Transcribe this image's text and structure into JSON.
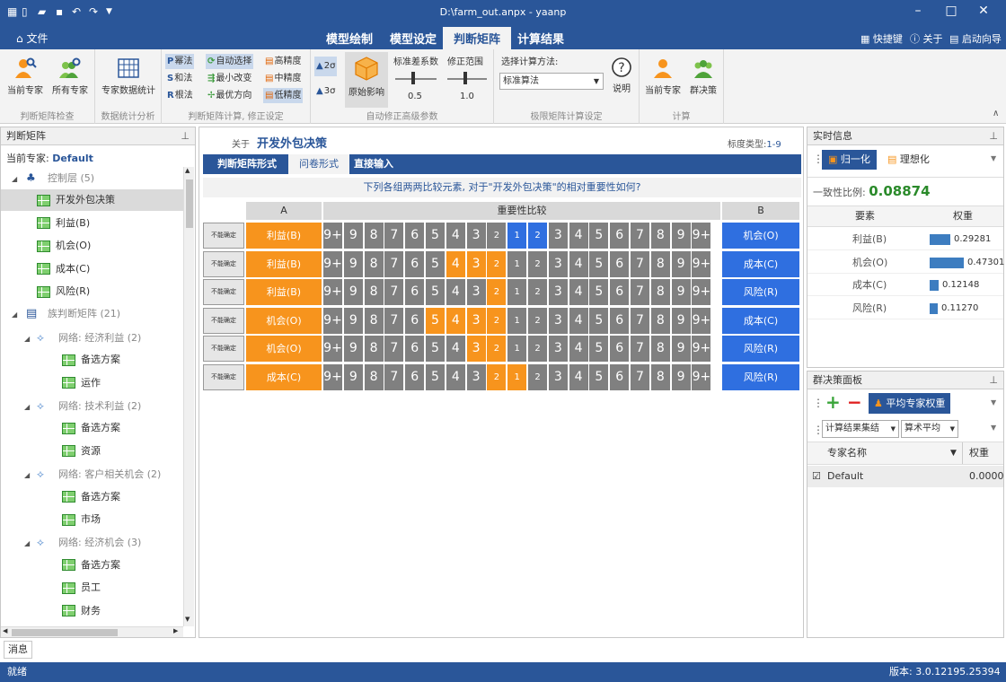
{
  "window": {
    "title": "D:\\farm_out.anpx - yaanp"
  },
  "menu": {
    "file": "文件",
    "tabs": [
      "模型绘制",
      "模型设定",
      "判断矩阵",
      "计算结果"
    ],
    "active": 2,
    "shortcut": "快捷键",
    "about": "关于",
    "wizard": "启动向导"
  },
  "ribbon": {
    "g1": {
      "caption": "判断矩阵检查",
      "b1": "当前专家",
      "b2": "所有专家"
    },
    "g2": {
      "caption": "数据统计分析",
      "b1": "专家数据统计"
    },
    "g3": {
      "caption": "判断矩阵计算, 修正设定",
      "pow": "幂法",
      "sum": "和法",
      "root": "根法",
      "auto": "自动选择",
      "minchg": "最小改变",
      "optdir": "最优方向",
      "high": "高精度",
      "mid": "中精度",
      "low": "低精度"
    },
    "g4": {
      "caption": "自动修正高级参数",
      "s2": "2σ",
      "s3": "3σ",
      "orig": "原始影响",
      "stddev": "标准差系数",
      "stddev_val": "0.5",
      "range": "修正范围",
      "range_val": "1.0"
    },
    "g5": {
      "caption": "极限矩阵计算设定",
      "label": "选择计算方法:",
      "method": "标准算法",
      "help": "说明"
    },
    "g6": {
      "caption": "计算",
      "b1": "当前专家",
      "b2": "群决策"
    }
  },
  "left": {
    "title": "判断矩阵",
    "expert_label": "当前专家:",
    "expert": "Default",
    "tree": [
      {
        "t": "控制层 (5)",
        "lv": 0,
        "kind": "hier",
        "exp": true
      },
      {
        "t": "开发外包决策",
        "lv": 1,
        "kind": "grid",
        "sel": true
      },
      {
        "t": "利益(B)",
        "lv": 1,
        "kind": "grid"
      },
      {
        "t": "机会(O)",
        "lv": 1,
        "kind": "grid"
      },
      {
        "t": "成本(C)",
        "lv": 1,
        "kind": "grid"
      },
      {
        "t": "风险(R)",
        "lv": 1,
        "kind": "grid"
      },
      {
        "t": "族判断矩阵 (21)",
        "lv": 0,
        "kind": "doc",
        "exp": true
      },
      {
        "t": "网络: 经济利益 (2)",
        "lv": 1,
        "kind": "net",
        "exp": true
      },
      {
        "t": "备选方案",
        "lv": 2,
        "kind": "grid"
      },
      {
        "t": "运作",
        "lv": 2,
        "kind": "grid"
      },
      {
        "t": "网络: 技术利益 (2)",
        "lv": 1,
        "kind": "net",
        "exp": true
      },
      {
        "t": "备选方案",
        "lv": 2,
        "kind": "grid"
      },
      {
        "t": "资源",
        "lv": 2,
        "kind": "grid"
      },
      {
        "t": "网络: 客户相关机会 (2)",
        "lv": 1,
        "kind": "net",
        "exp": true
      },
      {
        "t": "备选方案",
        "lv": 2,
        "kind": "grid"
      },
      {
        "t": "市场",
        "lv": 2,
        "kind": "grid"
      },
      {
        "t": "网络: 经济机会 (3)",
        "lv": 1,
        "kind": "net",
        "exp": true
      },
      {
        "t": "备选方案",
        "lv": 2,
        "kind": "grid"
      },
      {
        "t": "员工",
        "lv": 2,
        "kind": "grid"
      },
      {
        "t": "财务",
        "lv": 2,
        "kind": "grid"
      }
    ]
  },
  "center": {
    "about": "关于",
    "node": "开发外包决策",
    "scale_label": "标度类型:",
    "scale": "1-9",
    "tabs": [
      "判断矩阵形式",
      "问卷形式",
      "直接输入"
    ],
    "active": 1,
    "question": "下列各组两两比较元素, 对于\"开发外包决策\"的相对重要性如何?",
    "colA": "A",
    "colCmp": "重要性比较",
    "colB": "B",
    "cant": "不能确定",
    "scale_labels": [
      "9+",
      "9",
      "8",
      "7",
      "6",
      "5",
      "4",
      "3",
      "2",
      "1",
      "2",
      "3",
      "4",
      "5",
      "6",
      "7",
      "8",
      "9",
      "9+"
    ],
    "rows": [
      {
        "a": "利益(B)",
        "b": "机会(O)",
        "hl": [
          9,
          10
        ],
        "side": "b"
      },
      {
        "a": "利益(B)",
        "b": "成本(C)",
        "hl": [
          6,
          7,
          8
        ],
        "side": "a"
      },
      {
        "a": "利益(B)",
        "b": "风险(R)",
        "hl": [
          8
        ],
        "side": "a"
      },
      {
        "a": "机会(O)",
        "b": "成本(C)",
        "hl": [
          5,
          6,
          7,
          8
        ],
        "side": "a"
      },
      {
        "a": "机会(O)",
        "b": "风险(R)",
        "hl": [
          7,
          8
        ],
        "side": "a"
      },
      {
        "a": "成本(C)",
        "b": "风险(R)",
        "hl": [
          8,
          9
        ],
        "side": "a"
      }
    ]
  },
  "realtime": {
    "title": "实时信息",
    "norm": "归一化",
    "ideal": "理想化",
    "cr_label": "一致性比例:",
    "cr": "0.08874",
    "col_el": "要素",
    "col_w": "权重",
    "weights": [
      {
        "n": "利益(B)",
        "v": 0.29281,
        "t": "0.29281"
      },
      {
        "n": "机会(O)",
        "v": 0.47301,
        "t": "0.47301"
      },
      {
        "n": "成本(C)",
        "v": 0.12148,
        "t": "0.12148"
      },
      {
        "n": "风险(R)",
        "v": 0.1127,
        "t": "0.11270"
      }
    ]
  },
  "group": {
    "title": "群决策面板",
    "avg": "平均专家权重",
    "agg": "计算结果集结",
    "mean": "算术平均",
    "col_name": "专家名称",
    "col_w": "权重",
    "experts": [
      {
        "n": "Default",
        "w": "0.0000"
      }
    ]
  },
  "message": "消息",
  "status": {
    "left": "就绪",
    "right": "版本: 3.0.12195.25394"
  }
}
